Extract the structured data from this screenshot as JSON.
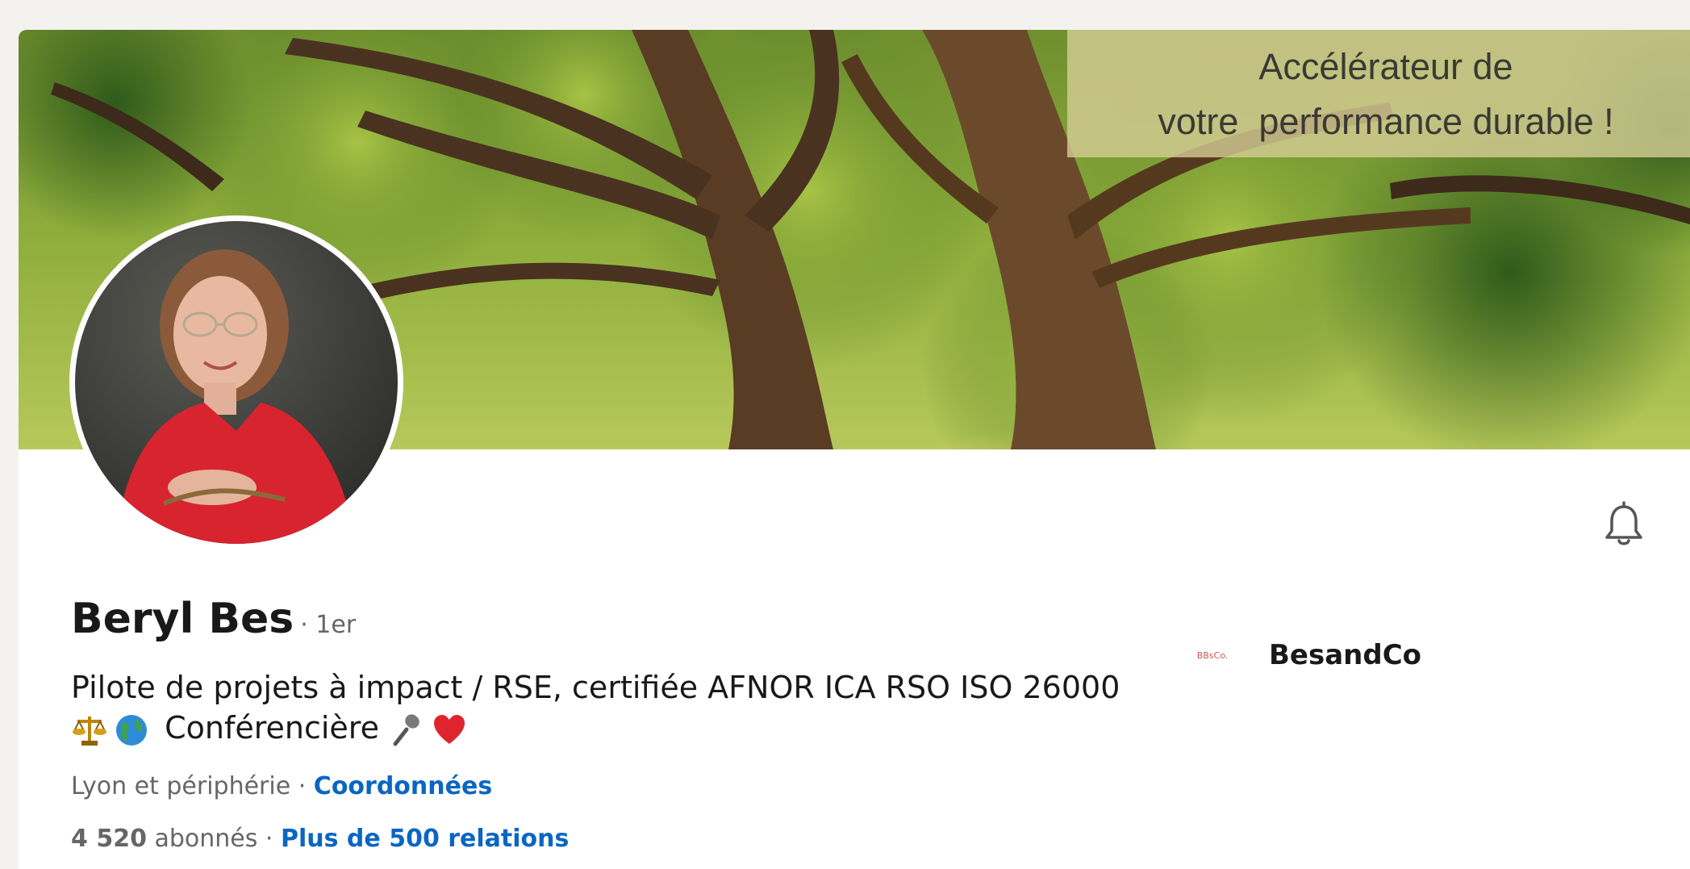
{
  "banner": {
    "tagline_line1": "Accélérateur de",
    "tagline_line2": "votre  performance durable !"
  },
  "profile": {
    "name": "Beryl Bes",
    "degree": "· 1er",
    "headline_line1": "Pilote de projets à impact / RSE, certifiée AFNOR ICA RSO ISO 26000",
    "headline_line2_text": " Conférencière ",
    "headline_emojis": [
      "scales-icon",
      "globe-icon",
      "microphone-icon",
      "heart-icon"
    ],
    "location": "Lyon et périphérie",
    "separator": " · ",
    "contact_link": "Coordonnées",
    "followers_count": "4 520",
    "followers_label": " abonnés ",
    "connections_link": "Plus de 500 relations"
  },
  "company": {
    "logo_text": "BBsCo.",
    "name": "BesandCo"
  },
  "icons": {
    "bell": "bell-icon"
  },
  "colors": {
    "link": "#0a66c2",
    "muted_text": "#666666",
    "page_bg": "#f3f2ef",
    "tagline_bg": "#d6cd96"
  }
}
